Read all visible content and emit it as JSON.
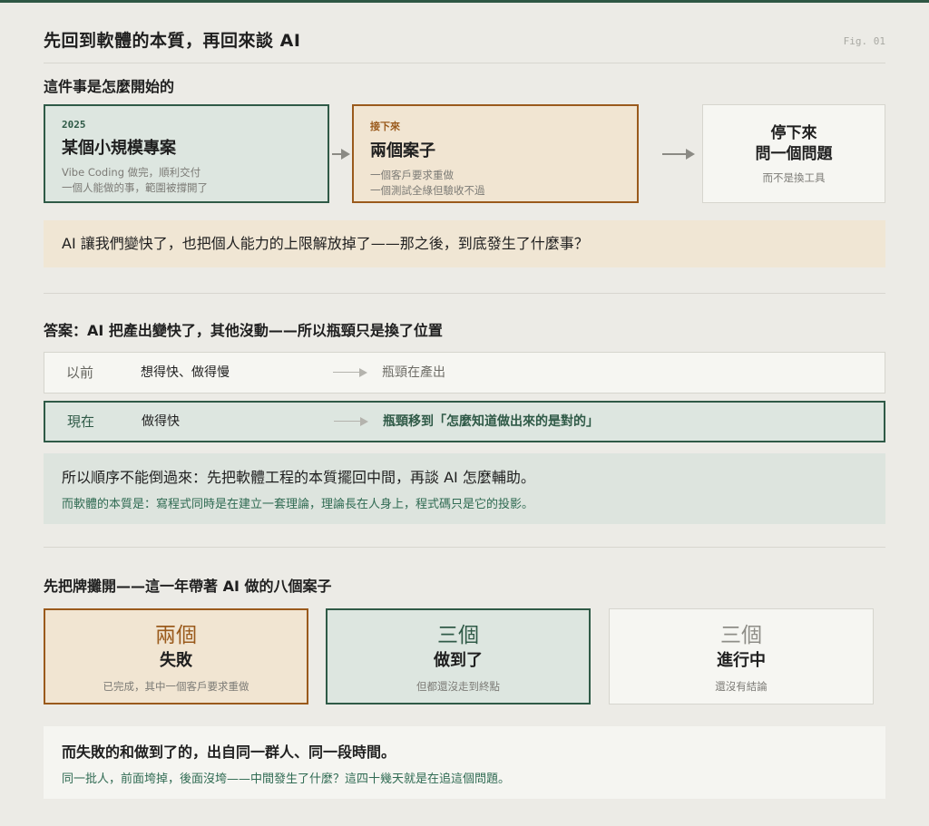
{
  "header": {
    "title": "先回到軟體的本質，再回來談 AI",
    "fig_label": "Fig. 01"
  },
  "section1": {
    "title": "這件事是怎麼開始的",
    "step1": {
      "tag": "2025",
      "title": "某個小規模專案",
      "lines": [
        "Vibe Coding 做完，順利交付",
        "一個人能做的事，範圍被撐開了"
      ]
    },
    "step2": {
      "tag": "接下來",
      "title": "兩個案子",
      "lines": [
        "一個客戶要求重做",
        "一個測試全綠但驗收不過"
      ]
    },
    "step3": {
      "title_lines": [
        "停下來",
        "問一個問題"
      ],
      "sub": "而不是換工具"
    },
    "question": "AI 讓我們變快了，也把個人能力的上限解放掉了——那之後，到底發生了什麼事？"
  },
  "section2": {
    "title": "答案：AI 把產出變快了，其他沒動——所以瓶頸只是換了位置",
    "rows": [
      {
        "label": "以前",
        "desc": "想得快、做得慢",
        "result": "瓶頸在產出"
      },
      {
        "label": "現在",
        "desc": "做得快",
        "result": "瓶頸移到「怎麼知道做出來的是對的」"
      }
    ],
    "note_main": "所以順序不能倒過來：先把軟體工程的本質擺回中間，再談 AI 怎麼輔助。",
    "note_sub": "而軟體的本質是：寫程式同時是在建立一套理論，理論長在人身上，程式碼只是它的投影。"
  },
  "section3": {
    "title": "先把牌攤開——這一年帶著 AI 做的八個案子",
    "cards": [
      {
        "count": "兩個",
        "label": "失敗",
        "sub": "已完成，其中一個客戶要求重做"
      },
      {
        "count": "三個",
        "label": "做到了",
        "sub": "但都還沒走到終點"
      },
      {
        "count": "三個",
        "label": "進行中",
        "sub": "還沒有結論"
      }
    ],
    "note_main": "而失敗的和做到了的，出自同一群人、同一段時間。",
    "note_sub": "同一批人，前面垮掉，後面沒垮——中間發生了什麼？這四十幾天就是在追這個問題。"
  },
  "colors": {
    "green": "#2f5a47",
    "brown": "#9a5a1c",
    "green_fill": "#dde6e0",
    "beige_fill": "#f1e5d2"
  }
}
